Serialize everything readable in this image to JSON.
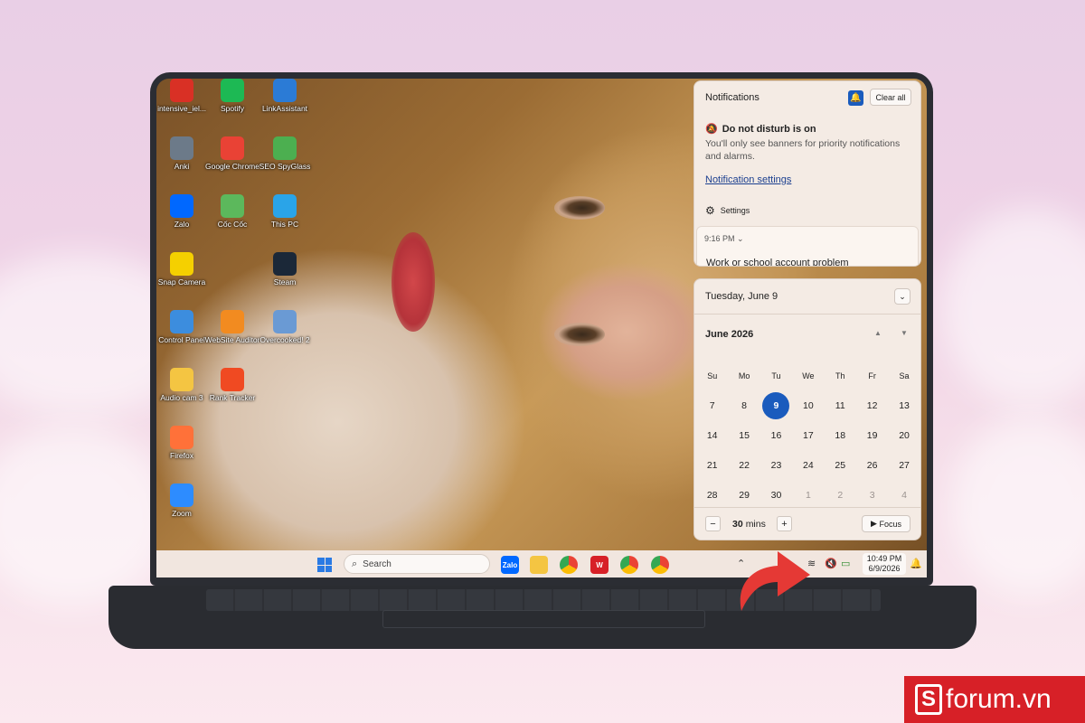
{
  "desktop_icons": [
    {
      "label": "intensive_iel...",
      "icon": "pdf-icon",
      "color": "#d93025"
    },
    {
      "label": "Spotify",
      "icon": "spotify-icon",
      "color": "#1db954"
    },
    {
      "label": "LinkAssistant",
      "icon": "linkassistant-icon",
      "color": "#2b7bd6"
    },
    {
      "label": "Anki",
      "icon": "anki-icon",
      "color": "#6c7a89"
    },
    {
      "label": "Google Chrome",
      "icon": "chrome-icon",
      "color": "#e94235"
    },
    {
      "label": "SEO SpyGlass",
      "icon": "spyglass-icon",
      "color": "#4caf50"
    },
    {
      "label": "Zalo",
      "icon": "zalo-icon",
      "color": "#0068ff"
    },
    {
      "label": "Cốc Cốc",
      "icon": "coccoc-icon",
      "color": "#5cb85c"
    },
    {
      "label": "This PC",
      "icon": "pc-icon",
      "color": "#2aa4e8"
    },
    {
      "label": "Snap Camera",
      "icon": "camera-icon",
      "color": "#f5d000"
    },
    {
      "label": "Steam",
      "icon": "steam-icon",
      "color": "#1b2838"
    },
    {
      "label": "Control Panel",
      "icon": "control-panel-icon",
      "color": "#3c8dde"
    },
    {
      "label": "WebSite Auditor",
      "icon": "auditor-icon",
      "color": "#f28b20"
    },
    {
      "label": "Overcooked! 2",
      "icon": "game-icon",
      "color": "#6a9ad4"
    },
    {
      "label": "Audio cam 3",
      "icon": "folder-icon",
      "color": "#f4c542"
    },
    {
      "label": "Rank Tracker",
      "icon": "rank-tracker-icon",
      "color": "#f04a22"
    },
    {
      "label": "Firefox",
      "icon": "firefox-icon",
      "color": "#ff7139"
    },
    {
      "label": "Zoom",
      "icon": "zoom-icon",
      "color": "#2d8cff"
    }
  ],
  "notifications": {
    "title": "Notifications",
    "clear_all": "Clear all",
    "dnd_title": "Do not disturb is on",
    "dnd_desc": "You'll only see banners for priority notifications and alarms.",
    "settings_link": "Notification settings",
    "settings_label": "Settings",
    "card_time": "9:16 PM",
    "card_msg": "Work or school account problem"
  },
  "calendar": {
    "date_header": "Tuesday, June 9",
    "month": "June 2026",
    "weekdays": [
      "Su",
      "Mo",
      "Tu",
      "We",
      "Th",
      "Fr",
      "Sa"
    ],
    "weeks": [
      [
        "7",
        "8",
        "9",
        "10",
        "11",
        "12",
        "13"
      ],
      [
        "14",
        "15",
        "16",
        "17",
        "18",
        "19",
        "20"
      ],
      [
        "21",
        "22",
        "23",
        "24",
        "25",
        "26",
        "27"
      ],
      [
        "28",
        "29",
        "30",
        "1",
        "2",
        "3",
        "4"
      ]
    ],
    "today": "9",
    "focus_minutes": "30",
    "focus_unit": "mins",
    "focus_label": "Focus"
  },
  "taskbar": {
    "search_placeholder": "Search",
    "time": "10:49 PM",
    "date": "6/9/2026"
  },
  "brand": "forum.vn",
  "colors": {
    "accent": "#1a5bbd",
    "brand_red": "#d72027",
    "arrow_red": "#e53935"
  }
}
